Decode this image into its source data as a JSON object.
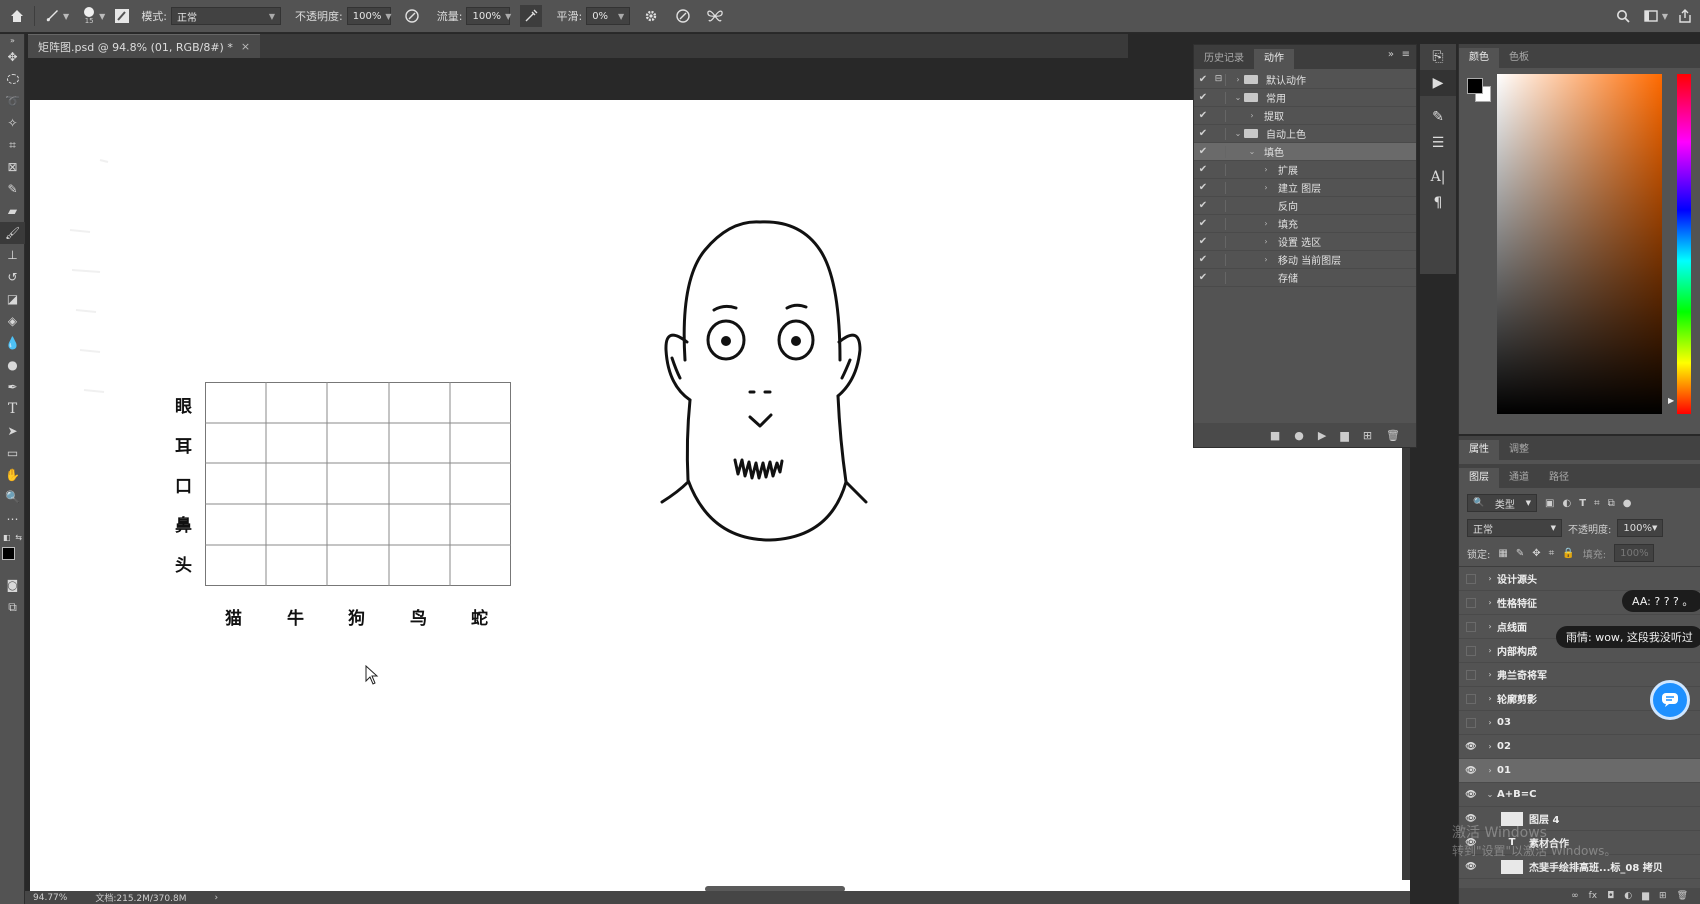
{
  "options_bar": {
    "brush_size": "15",
    "mode_label": "模式:",
    "mode_value": "正常",
    "opacity_label": "不透明度:",
    "opacity_value": "100%",
    "flow_label": "流量:",
    "flow_value": "100%",
    "smoothing_label": "平滑:",
    "smoothing_value": "0%"
  },
  "document_tab": {
    "title": "矩阵图.psd @ 94.8% (01, RGB/8#) *",
    "close": "×"
  },
  "status_bar": {
    "zoom": "94.77%",
    "doc_info": "文档:215.2M/370.8M",
    "arrow": "›"
  },
  "canvas": {
    "matrix": {
      "row_labels": [
        "眼",
        "耳",
        "口",
        "鼻",
        "头"
      ],
      "column_labels": [
        "猫",
        "牛",
        "狗",
        "鸟",
        "蛇"
      ]
    }
  },
  "actions_panel": {
    "tabs": [
      "历史记录",
      "动作"
    ],
    "active_tab": "动作",
    "items": [
      {
        "label": "默认动作",
        "level": 0,
        "folder": true,
        "expanded": false
      },
      {
        "label": "常用",
        "level": 0,
        "folder": true,
        "expanded": true
      },
      {
        "label": "提取",
        "level": 1,
        "folder": false,
        "expanded": false
      },
      {
        "label": "自动上色",
        "level": 0,
        "folder": true,
        "expanded": true
      },
      {
        "label": "填色",
        "level": 1,
        "folder": false,
        "expanded": true,
        "selected": true
      },
      {
        "label": "扩展",
        "level": 2,
        "folder": false,
        "expanded": false
      },
      {
        "label": "建立 图层",
        "level": 2,
        "folder": false,
        "expanded": false
      },
      {
        "label": "反向",
        "level": 2,
        "folder": false,
        "expanded": null
      },
      {
        "label": "填充",
        "level": 2,
        "folder": false,
        "expanded": false
      },
      {
        "label": "设置 选区",
        "level": 2,
        "folder": false,
        "expanded": false
      },
      {
        "label": "移动 当前图层",
        "level": 2,
        "folder": false,
        "expanded": false
      },
      {
        "label": "存储",
        "level": 2,
        "folder": false,
        "expanded": null
      }
    ]
  },
  "color_panel": {
    "tabs": [
      "颜色",
      "色板"
    ],
    "foreground": "#000000",
    "background": "#ffffff"
  },
  "properties_tabs": [
    "属性",
    "调整"
  ],
  "layers_panel": {
    "tabs": [
      "图层",
      "通道",
      "路径"
    ],
    "filter_label": "类型",
    "blend_mode": "正常",
    "opacity_label": "不透明度:",
    "opacity_value": "100%",
    "lock_label": "锁定:",
    "fill_label": "填充:",
    "fill_value": "100%",
    "layers": [
      {
        "name": "设计源头",
        "visible": false,
        "group": true
      },
      {
        "name": "性格特征",
        "visible": false,
        "group": true
      },
      {
        "name": "点线面",
        "visible": false,
        "group": true
      },
      {
        "name": "内部构成",
        "visible": false,
        "group": true
      },
      {
        "name": "弗兰奇将军",
        "visible": false,
        "group": true
      },
      {
        "name": "轮廓剪影",
        "visible": false,
        "group": true
      },
      {
        "name": "03",
        "visible": false,
        "group": true
      },
      {
        "name": "02",
        "visible": true,
        "group": true
      },
      {
        "name": "01",
        "visible": true,
        "group": true,
        "selected": true
      },
      {
        "name": "A+B=C",
        "visible": true,
        "group": true,
        "expanded": true
      },
      {
        "name": "图层 4",
        "visible": true,
        "group": false
      },
      {
        "name": "素材合作",
        "visible": true,
        "group": false,
        "text_layer": true
      },
      {
        "name": "杰斐手绘排高班...标_08 拷贝",
        "visible": true,
        "group": false
      }
    ]
  },
  "overlays": {
    "bubble_1": "AA: ? ? ? 。",
    "bubble_2": "雨情: wow, 这段我没听过",
    "watermark_1": "激活 Windows",
    "watermark_2": "转到\"设置\"以激活 Windows。"
  }
}
